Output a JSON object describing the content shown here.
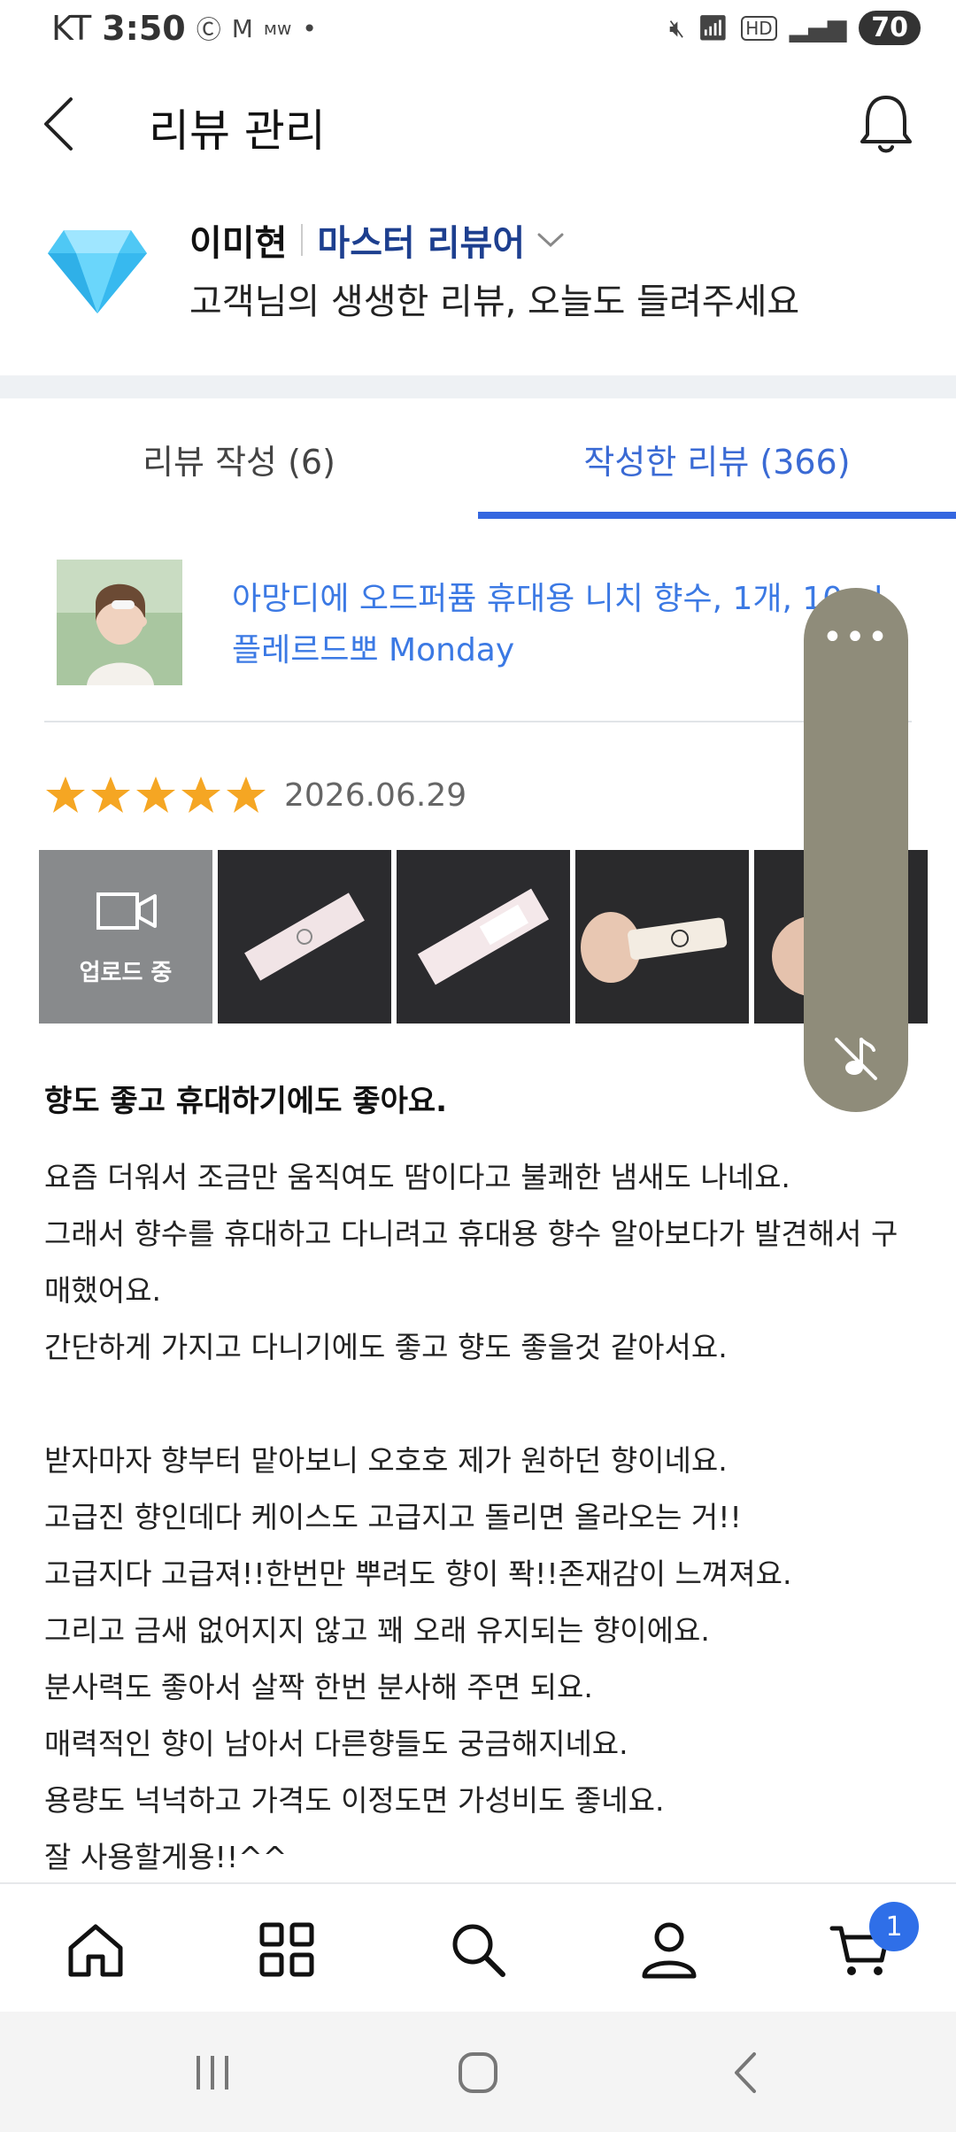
{
  "status_bar": {
    "carrier": "KT",
    "time": "3:50",
    "battery": "70"
  },
  "header": {
    "title": "리뷰 관리"
  },
  "profile": {
    "name": "이미현",
    "grade": "마스터 리뷰어",
    "tagline": "고객님의 생생한 리뷰, 오늘도 들려주세요"
  },
  "tabs": [
    {
      "label": "리뷰 작성 (6)"
    },
    {
      "label": "작성한 리뷰 (366)"
    }
  ],
  "review": {
    "product_title": "아망디에 오드퍼퓸 휴대용 니치 향수, 1개, 10ml, 플레르드뽀 Monday",
    "rating": 5,
    "date": "2026.06.29",
    "upload_status": "업로드 중",
    "headline": "향도 좋고 휴대하기에도 좋아요.",
    "body": "요즘 더워서 조금만 움직여도 땀이다고 불쾌한 냄새도 나네요.\n그래서 향수를 휴대하고 다니려고 휴대용 향수 알아보다가 발견해서 구매했어요.\n간단하게 가지고 다니기에도 좋고 향도 좋을것 같아서요.\n\n받자마자 향부터 맡아보니 오호호 제가 원하던 향이네요.\n고급진 향인데다 케이스도 고급지고 돌리면 올라오는 거!!\n고급지다 고급져!!한번만 뿌려도 향이 퐉!!존재감이 느껴져요.\n그리고 금새 없어지지 않고 꽤 오래 유지되는 향이에요.\n분사력도 좋아서 살짝 한번 분사해 주면 되요.\n매력적인 향이 남아서 다른향들도 궁금해지네요.\n용량도 넉넉하고 가격도 이정도면 가성비도 좋네요.\n잘 사용할게용!!^^"
  },
  "floating_panel": {
    "icons": [
      "more-dots-icon",
      "music-mute-icon"
    ]
  },
  "bottom_nav": {
    "items": [
      "home-icon",
      "category-grid-icon",
      "search-icon",
      "my-account-icon",
      "cart-icon"
    ],
    "cart_count": "1"
  },
  "colors": {
    "accent": "#3567e0",
    "link": "#3b79e4",
    "grade": "#1d3f8f",
    "star": "#f5a623",
    "badge": "#2f6fe8"
  }
}
